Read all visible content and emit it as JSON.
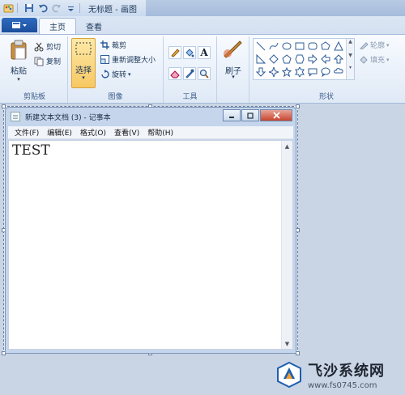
{
  "window": {
    "title": "无标题 - 画图"
  },
  "tabs": [
    "主页",
    "查看"
  ],
  "ribbon": {
    "clipboard": {
      "paste": "粘贴",
      "cut": "剪切",
      "copy": "复制",
      "label": "剪贴板"
    },
    "image": {
      "select": "选择",
      "crop": "裁剪",
      "resize": "重新调整大小",
      "rotate": "旋转",
      "label": "图像"
    },
    "tools": {
      "label": "工具"
    },
    "brushes": {
      "label": "刷子"
    },
    "shapes": {
      "outline": "轮廓",
      "fill": "填充",
      "label": "形状"
    }
  },
  "notepad": {
    "title": "新建文本文档 (3) - 记事本",
    "menu": [
      "文件(F)",
      "编辑(E)",
      "格式(O)",
      "查看(V)",
      "帮助(H)"
    ],
    "content": "TEST"
  },
  "watermark": {
    "title": "飞沙系统网",
    "url": "www.fs0745.com"
  },
  "colors": {
    "accent": "#2f6bc0",
    "select_highlight": "#f7c862",
    "close": "#c7452f"
  }
}
